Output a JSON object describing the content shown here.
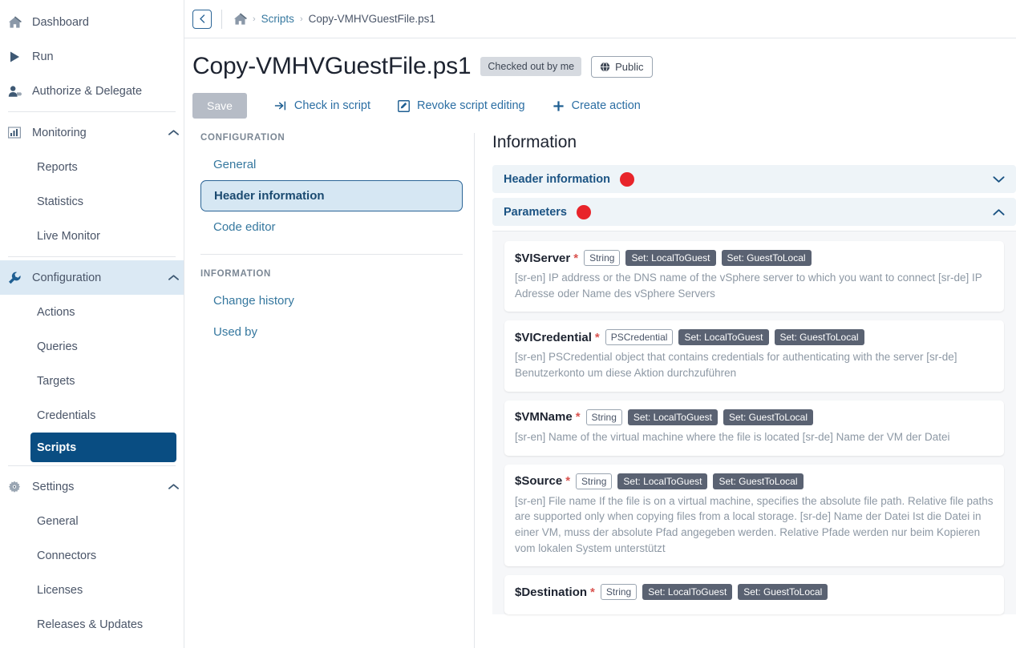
{
  "sidebar": {
    "items": [
      {
        "label": "Dashboard",
        "icon": "home-icon",
        "type": "item"
      },
      {
        "label": "Run",
        "icon": "play-icon",
        "type": "item"
      },
      {
        "label": "Authorize & Delegate",
        "icon": "user-tag-icon",
        "type": "item"
      },
      {
        "label": "Monitoring",
        "icon": "chart-bar-icon",
        "type": "group",
        "expanded": true
      },
      {
        "label": "Reports",
        "type": "sub"
      },
      {
        "label": "Statistics",
        "type": "sub"
      },
      {
        "label": "Live Monitor",
        "type": "sub"
      },
      {
        "label": "Configuration",
        "icon": "wrench-icon",
        "type": "group",
        "expanded": true,
        "active_group": true
      },
      {
        "label": "Actions",
        "type": "sub"
      },
      {
        "label": "Queries",
        "type": "sub"
      },
      {
        "label": "Targets",
        "type": "sub"
      },
      {
        "label": "Credentials",
        "type": "sub"
      },
      {
        "label": "Scripts",
        "type": "sub",
        "active": true
      },
      {
        "label": "Settings",
        "icon": "gear-icon",
        "type": "group",
        "expanded": true
      },
      {
        "label": "General",
        "type": "sub"
      },
      {
        "label": "Connectors",
        "type": "sub"
      },
      {
        "label": "Licenses",
        "type": "sub"
      },
      {
        "label": "Releases & Updates",
        "type": "sub"
      }
    ],
    "active_color": "#094d82",
    "group_active_bg": "#dbe9f4"
  },
  "breadcrumb": {
    "back_label": "‹",
    "home_icon": "home-icon",
    "separator": "›",
    "items": [
      {
        "label": "Scripts",
        "last": false
      },
      {
        "label": "Copy-VMHVGuestFile.ps1",
        "last": true
      }
    ]
  },
  "header": {
    "title": "Copy-VMHVGuestFile.ps1",
    "status_badge": "Checked out by me",
    "visibility_badge": "Public",
    "visibility_icon": "globe-icon"
  },
  "toolbar": {
    "save_label": "Save",
    "actions": [
      {
        "label": "Check in script",
        "icon": "sign-in-icon"
      },
      {
        "label": "Revoke script editing",
        "icon": "edit-icon"
      },
      {
        "label": "Create action",
        "icon": "plus-icon"
      }
    ]
  },
  "config_panel": {
    "section_configuration": "CONFIGURATION",
    "configuration_items": [
      {
        "label": "General",
        "selected": false
      },
      {
        "label": "Header information",
        "selected": true
      },
      {
        "label": "Code editor",
        "selected": false
      }
    ],
    "section_information": "INFORMATION",
    "information_items": [
      {
        "label": "Change history",
        "selected": false
      },
      {
        "label": "Used by",
        "selected": false
      }
    ]
  },
  "information": {
    "title": "Information",
    "accordions": [
      {
        "label": "Header information",
        "has_error_dot": true,
        "expanded": false,
        "chevron": "chevron-down-icon"
      },
      {
        "label": "Parameters",
        "has_error_dot": true,
        "expanded": true,
        "chevron": "chevron-up-icon"
      }
    ],
    "error_dot_color": "#e8242a",
    "parameters": [
      {
        "name": "$VIServer",
        "required": "*",
        "type": "String",
        "badges": [
          "Set: LocalToGuest",
          "Set: GuestToLocal"
        ],
        "description": "[sr-en] IP address or the DNS name of the vSphere server to which you want to connect [sr-de] IP Adresse oder Name des vSphere Servers"
      },
      {
        "name": "$VICredential",
        "required": "*",
        "type": "PSCredential",
        "badges": [
          "Set: LocalToGuest",
          "Set: GuestToLocal"
        ],
        "description": "[sr-en] PSCredential object that contains credentials for authenticating with the server [sr-de] Benutzerkonto um diese Aktion durchzuführen"
      },
      {
        "name": "$VMName",
        "required": "*",
        "type": "String",
        "badges": [
          "Set: LocalToGuest",
          "Set: GuestToLocal"
        ],
        "description": "[sr-en] Name of the virtual machine where the file is located [sr-de] Name der VM der Datei"
      },
      {
        "name": "$Source",
        "required": "*",
        "type": "String",
        "badges": [
          "Set: LocalToGuest",
          "Set: GuestToLocal"
        ],
        "description": "[sr-en] File name If the file is on a virtual machine, specifies the absolute file path. Relative file paths are supported only when copying files from a local storage. [sr-de] Name der Datei Ist die Datei in einer VM, muss der absolute Pfad angegeben werden. Relative Pfade werden nur beim Kopieren vom lokalen System unterstützt"
      },
      {
        "name": "$Destination",
        "required": "*",
        "type": "String",
        "badges": [
          "Set: LocalToGuest",
          "Set: GuestToLocal"
        ],
        "description": ""
      }
    ]
  }
}
